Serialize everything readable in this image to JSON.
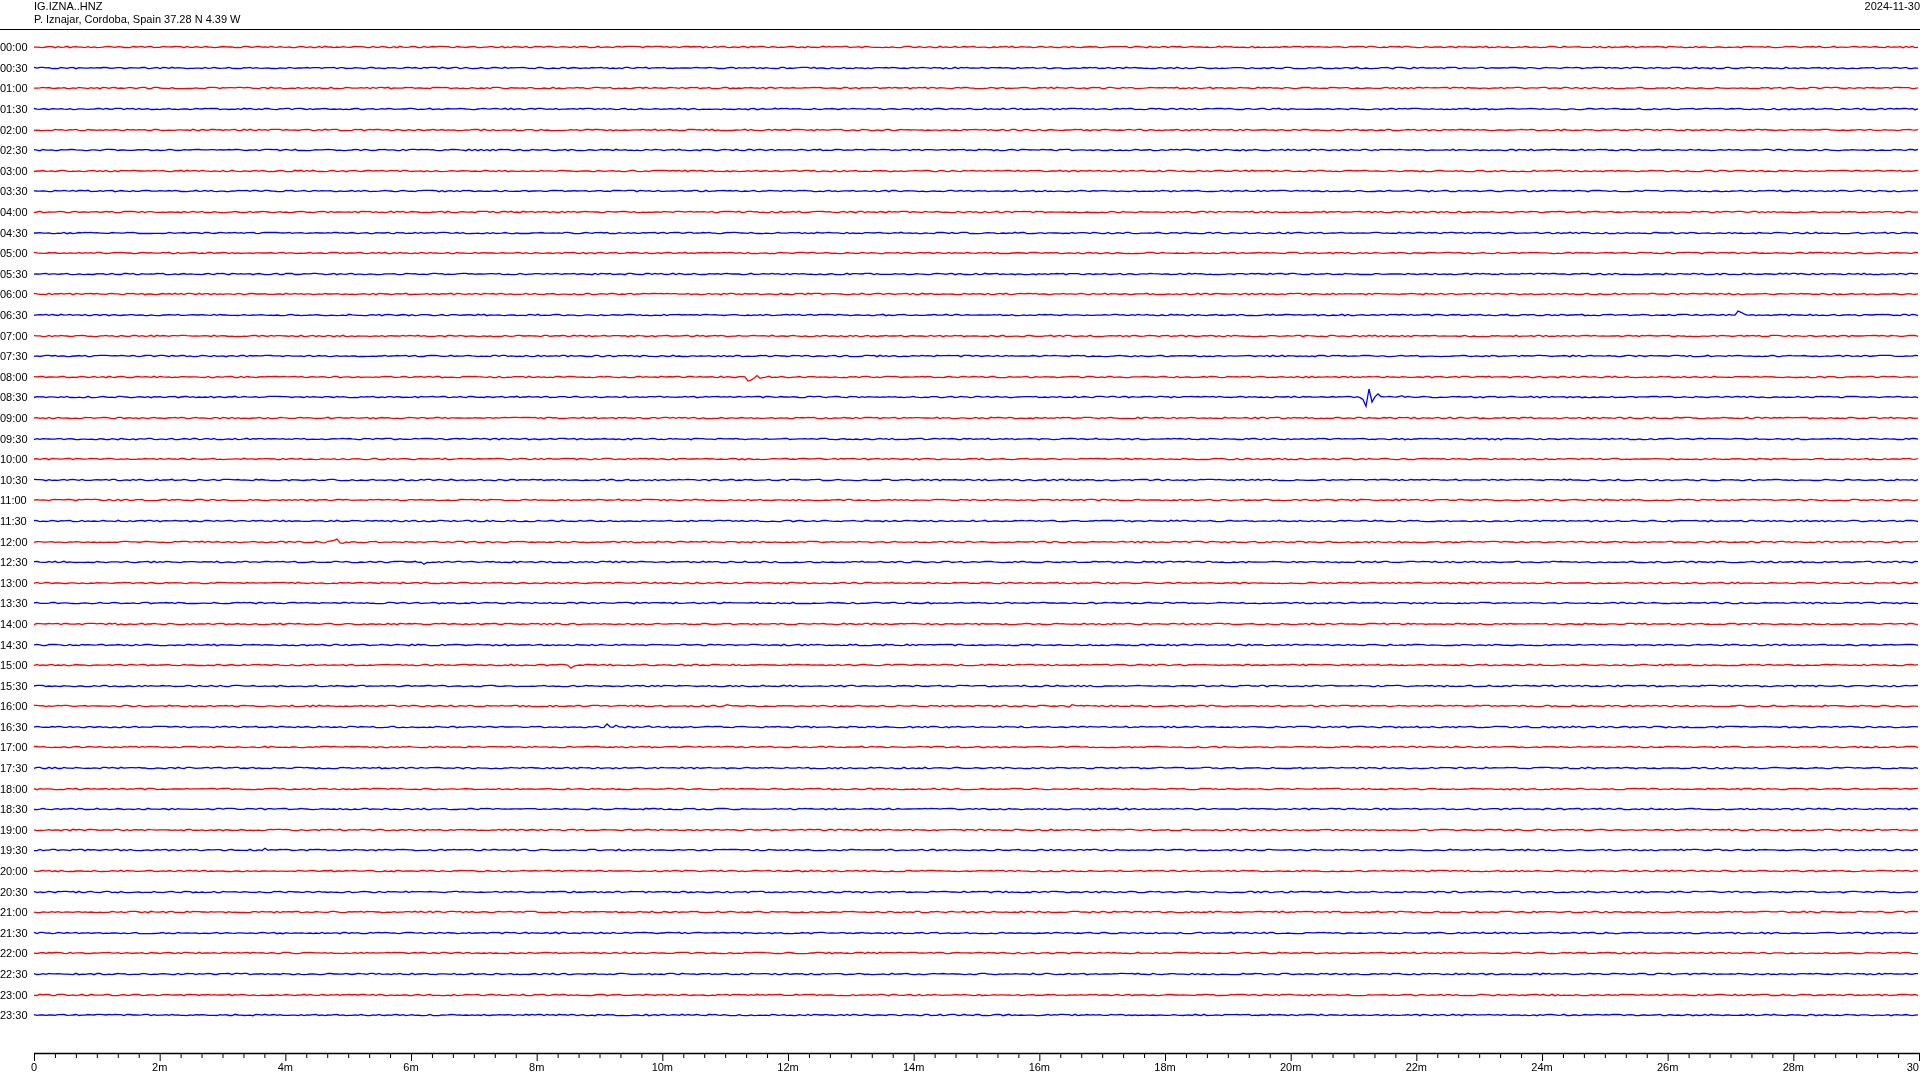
{
  "header": {
    "station": "IG.IZNA..HNZ",
    "location": "P. Iznajar, Cordoba, Spain  37.28 N 4.39 W",
    "date": "2024-11-30"
  },
  "rows": [
    {
      "time": "00:00",
      "color": "#ff0000"
    },
    {
      "time": "00:30",
      "color": "#0000ff"
    },
    {
      "time": "01:00",
      "color": "#ff0000"
    },
    {
      "time": "01:30",
      "color": "#0000ff"
    },
    {
      "time": "02:00",
      "color": "#ff0000"
    },
    {
      "time": "02:30",
      "color": "#0000ff"
    },
    {
      "time": "03:00",
      "color": "#ff0000"
    },
    {
      "time": "03:30",
      "color": "#0000ff"
    },
    {
      "time": "04:00",
      "color": "#ff0000"
    },
    {
      "time": "04:30",
      "color": "#0000ff"
    },
    {
      "time": "05:00",
      "color": "#ff0000"
    },
    {
      "time": "05:30",
      "color": "#0000ff"
    },
    {
      "time": "06:00",
      "color": "#ff0000"
    },
    {
      "time": "06:30",
      "color": "#0000ff"
    },
    {
      "time": "07:00",
      "color": "#ff0000"
    },
    {
      "time": "07:30",
      "color": "#0000ff"
    },
    {
      "time": "08:00",
      "color": "#ff0000"
    },
    {
      "time": "08:30",
      "color": "#0000ff"
    },
    {
      "time": "09:00",
      "color": "#ff0000"
    },
    {
      "time": "09:30",
      "color": "#0000ff"
    },
    {
      "time": "10:00",
      "color": "#ff0000"
    },
    {
      "time": "10:30",
      "color": "#0000ff"
    },
    {
      "time": "11:00",
      "color": "#ff0000"
    },
    {
      "time": "11:30",
      "color": "#0000ff"
    },
    {
      "time": "12:00",
      "color": "#ff0000"
    },
    {
      "time": "12:30",
      "color": "#0000ff"
    },
    {
      "time": "13:00",
      "color": "#ff0000"
    },
    {
      "time": "13:30",
      "color": "#0000ff"
    },
    {
      "time": "14:00",
      "color": "#ff0000"
    },
    {
      "time": "14:30",
      "color": "#0000ff"
    },
    {
      "time": "15:00",
      "color": "#ff0000"
    },
    {
      "time": "15:30",
      "color": "#0000ff"
    },
    {
      "time": "16:00",
      "color": "#ff0000"
    },
    {
      "time": "16:30",
      "color": "#0000ff"
    },
    {
      "time": "17:00",
      "color": "#ff0000"
    },
    {
      "time": "17:30",
      "color": "#0000ff"
    },
    {
      "time": "18:00",
      "color": "#ff0000"
    },
    {
      "time": "18:30",
      "color": "#0000ff"
    },
    {
      "time": "19:00",
      "color": "#ff0000"
    },
    {
      "time": "19:30",
      "color": "#0000ff"
    },
    {
      "time": "20:00",
      "color": "#ff0000"
    },
    {
      "time": "20:30",
      "color": "#0000ff"
    },
    {
      "time": "21:00",
      "color": "#ff0000"
    },
    {
      "time": "21:30",
      "color": "#0000ff"
    },
    {
      "time": "22:00",
      "color": "#ff0000"
    },
    {
      "time": "22:30",
      "color": "#0000ff"
    },
    {
      "time": "23:00",
      "color": "#ff0000"
    },
    {
      "time": "23:30",
      "color": "#0000ff"
    }
  ],
  "axis": {
    "ticks": [
      "0",
      "2m",
      "4m",
      "6m",
      "8m",
      "10m",
      "12m",
      "14m",
      "16m",
      "18m",
      "20m",
      "22m",
      "24m",
      "26m",
      "28m",
      "30"
    ]
  }
}
